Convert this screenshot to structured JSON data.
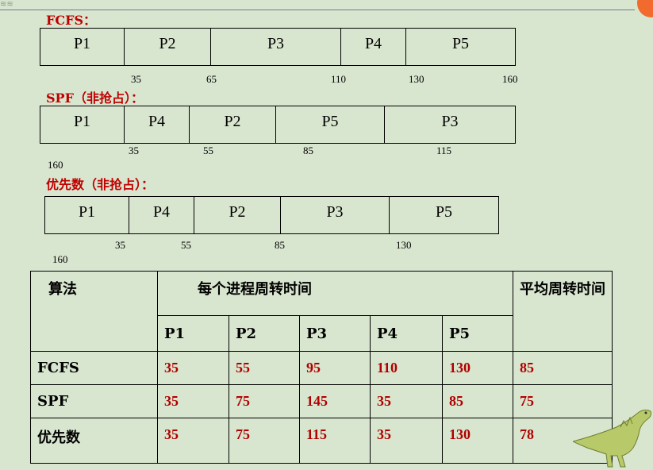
{
  "fcfs": {
    "heading": "FCFS：",
    "blocks": [
      "P1",
      "P2",
      "P3",
      "P4",
      "P5"
    ],
    "ticks": [
      "35",
      "65",
      "110",
      "130",
      "160"
    ]
  },
  "spf": {
    "heading": "SPF（非抢占）：",
    "blocks": [
      "P1",
      "P4",
      "P2",
      "P5",
      "P3"
    ],
    "ticks": [
      "35",
      "55",
      "85",
      "115",
      "160"
    ]
  },
  "priority": {
    "heading": "优先数（非抢占）：",
    "blocks": [
      "P1",
      "P4",
      "P2",
      "P3",
      "P5"
    ],
    "ticks": [
      "35",
      "55",
      "85",
      "130",
      "160"
    ]
  },
  "table": {
    "col_algo": "算法",
    "col_turnaround": "每个进程周转时间",
    "col_avg": "平均周转时间",
    "procs": [
      "P1",
      "P2",
      "P3",
      "P4",
      "P5"
    ],
    "rows": [
      {
        "algo": "FCFS",
        "vals": [
          "35",
          "55",
          "95",
          "110",
          "130"
        ],
        "avg": "85"
      },
      {
        "algo": "SPF",
        "vals": [
          "35",
          "75",
          "145",
          "35",
          "85"
        ],
        "avg": "75"
      },
      {
        "algo": "优先数",
        "vals": [
          "35",
          "75",
          "115",
          "35",
          "130"
        ],
        "avg": "78"
      }
    ]
  },
  "colors": {
    "background": "#d9e6cf",
    "heading": "#c00000",
    "value": "#b00000"
  }
}
